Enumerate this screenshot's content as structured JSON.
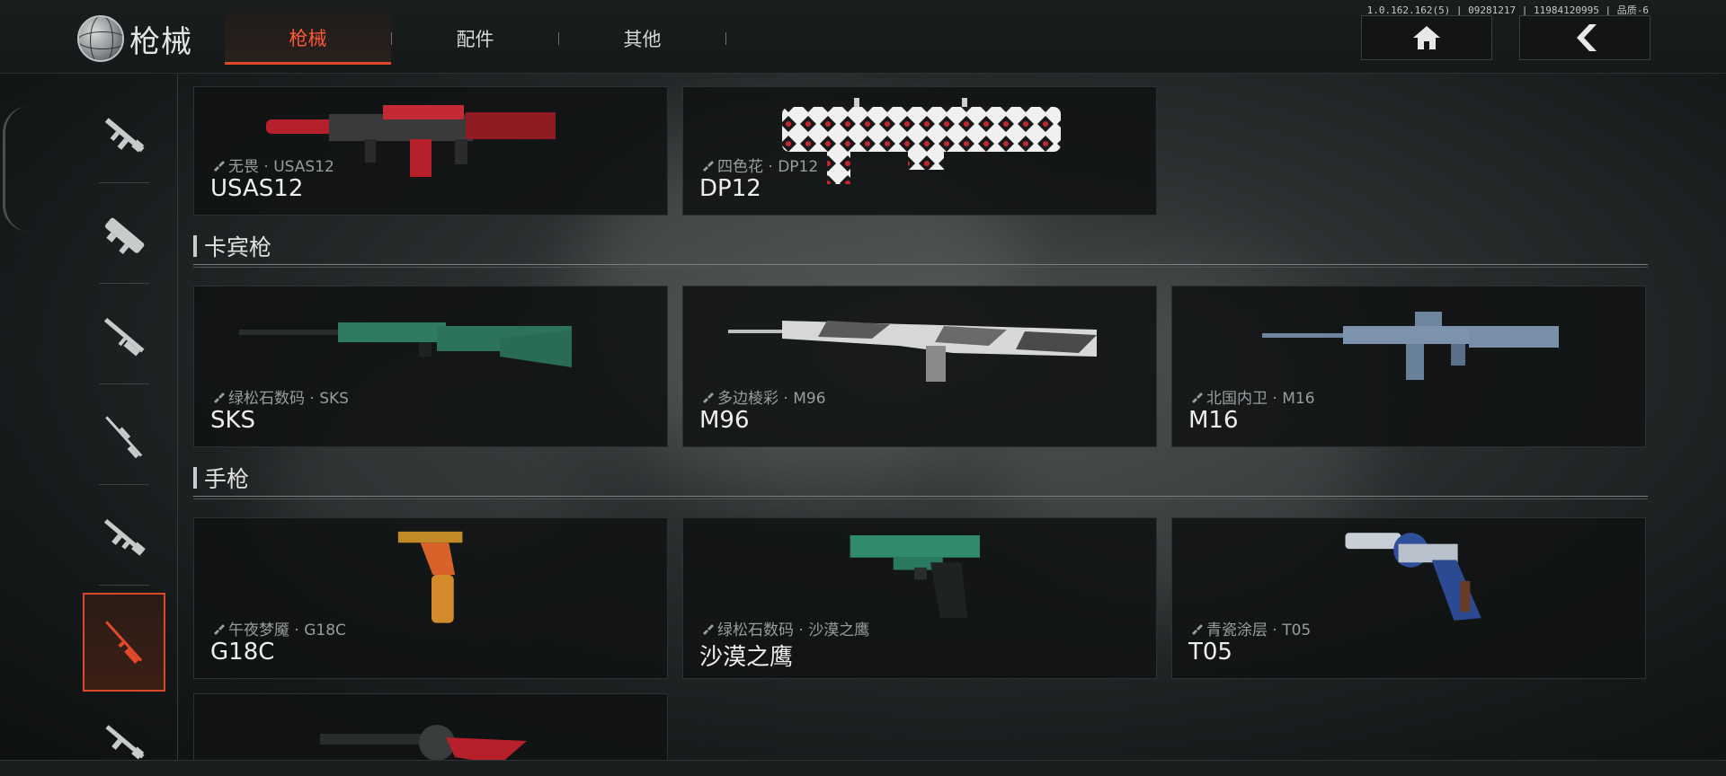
{
  "header": {
    "title": "枪械",
    "tabs": [
      {
        "label": "枪械",
        "active": true
      },
      {
        "label": "配件",
        "active": false
      },
      {
        "label": "其他",
        "active": false
      }
    ],
    "version": "1.0.162.162(5) | 09281217 | 11984120995 | 品质-6",
    "home_icon": "home-icon",
    "back_icon": "chevron-left-icon"
  },
  "colors": {
    "accent": "#e2492a",
    "active_tab_text": "#ff5a36"
  },
  "sidebar": {
    "items": [
      {
        "icon": "assault-rifle-icon",
        "active": false
      },
      {
        "icon": "smg-icon",
        "active": false
      },
      {
        "icon": "shotgun-icon",
        "active": false
      },
      {
        "icon": "sniper-rifle-icon",
        "active": false
      },
      {
        "icon": "machine-gun-icon",
        "active": false
      },
      {
        "icon": "rifle-icon",
        "active": true
      },
      {
        "icon": "carbine-icon",
        "active": false
      }
    ]
  },
  "sections": [
    {
      "cards": [
        {
          "skin": "无畏 · USAS12",
          "name": "USAS12"
        },
        {
          "skin": "四色花 · DP12",
          "name": "DP12"
        }
      ]
    },
    {
      "title": "卡宾枪",
      "cards": [
        {
          "skin": "绿松石数码 · SKS",
          "name": "SKS"
        },
        {
          "skin": "多边棱彩 · M96",
          "name": "M96"
        },
        {
          "skin": "北国内卫 · M16",
          "name": "M16"
        }
      ]
    },
    {
      "title": "手枪",
      "cards": [
        {
          "skin": "午夜梦魇 · G18C",
          "name": "G18C"
        },
        {
          "skin": "绿松石数码 · 沙漠之鹰",
          "name": "沙漠之鹰"
        },
        {
          "skin": "青瓷涂层 · T05",
          "name": "T05"
        }
      ]
    }
  ]
}
